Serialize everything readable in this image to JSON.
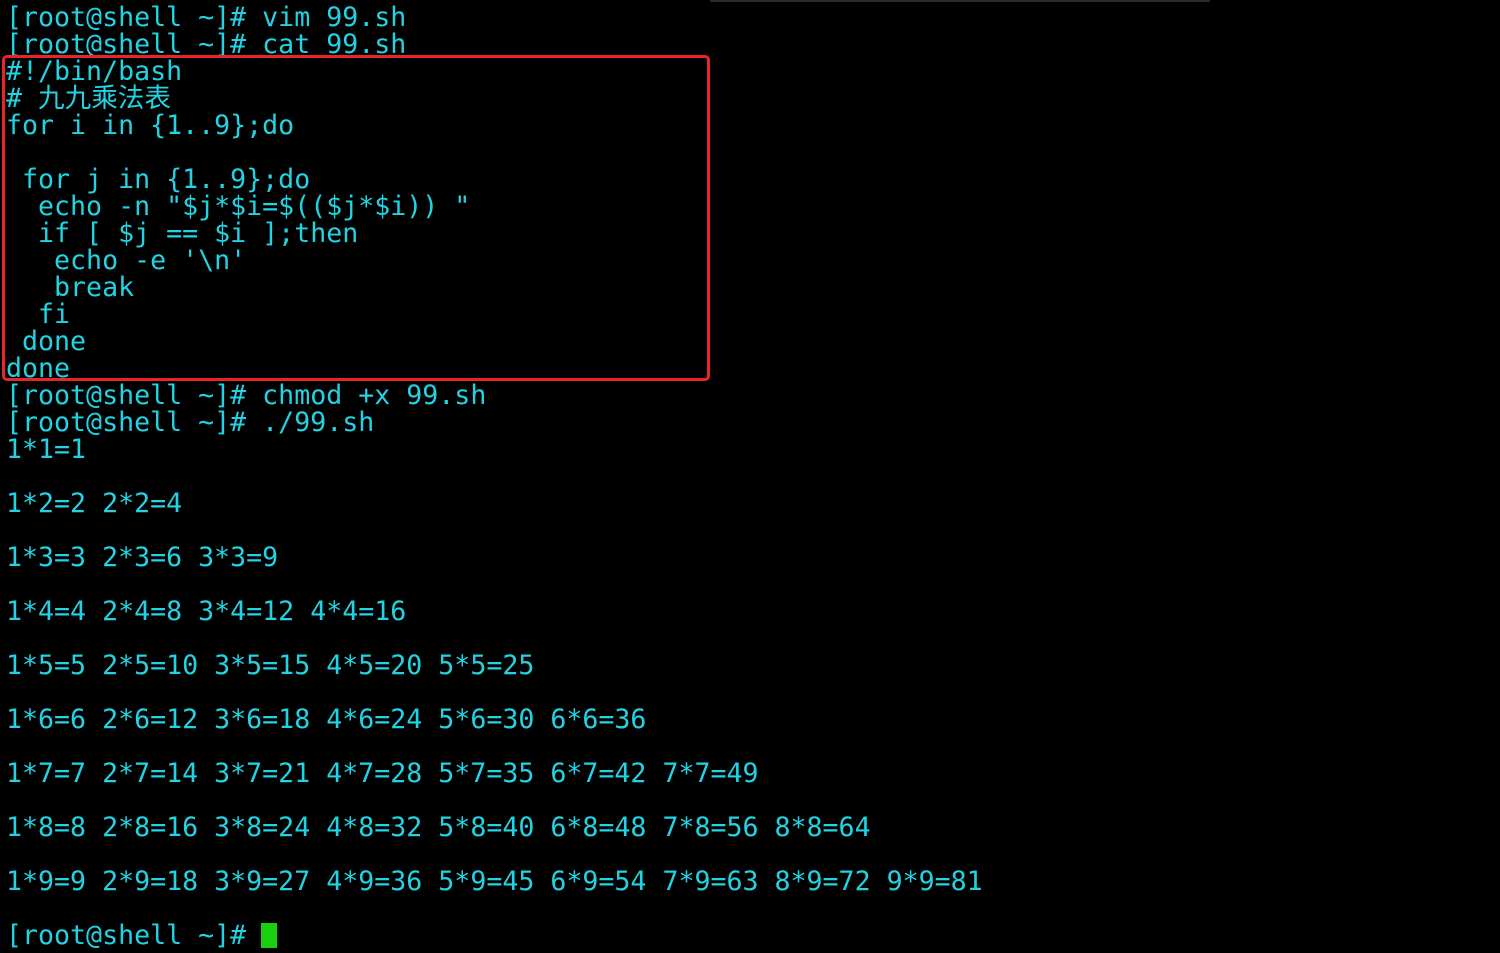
{
  "terminal": {
    "lines": [
      "[root@shell ~]# vim 99.sh",
      "[root@shell ~]# cat 99.sh",
      "#!/bin/bash",
      "# 九九乘法表",
      "for i in {1..9};do",
      "",
      " for j in {1..9};do",
      "  echo -n \"$j*$i=$(($j*$i)) \"",
      "  if [ $j == $i ];then",
      "   echo -e '\\n'",
      "   break",
      "  fi",
      " done",
      "done",
      "[root@shell ~]# chmod +x 99.sh",
      "[root@shell ~]# ./99.sh",
      "1*1=1",
      "",
      "1*2=2 2*2=4",
      "",
      "1*3=3 2*3=6 3*3=9",
      "",
      "1*4=4 2*4=8 3*4=12 4*4=16",
      "",
      "1*5=5 2*5=10 3*5=15 4*5=20 5*5=25",
      "",
      "1*6=6 2*6=12 3*6=18 4*6=24 5*6=30 6*6=36",
      "",
      "1*7=7 2*7=14 3*7=21 4*7=28 5*7=35 6*7=42 7*7=49",
      "",
      "1*8=8 2*8=16 3*8=24 4*8=32 5*8=40 6*8=48 7*8=56 8*8=64",
      "",
      "1*9=9 2*9=18 3*9=27 4*9=36 5*9=45 6*9=54 7*9=63 8*9=72 9*9=81",
      "",
      "[root@shell ~]# "
    ]
  },
  "colors": {
    "background": "#000000",
    "text": "#22d3e3",
    "highlight": "#e8262a",
    "cursor": "#1ad00e"
  }
}
